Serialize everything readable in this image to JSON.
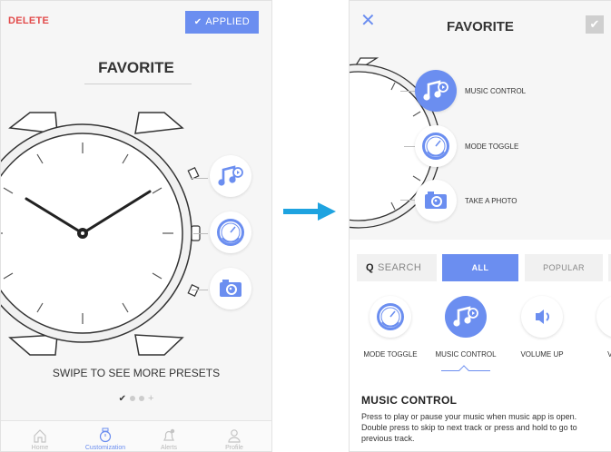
{
  "left": {
    "delete_label": "DELETE",
    "applied_label": "APPLIED",
    "title": "FAVORITE",
    "swipe_text": "SWIPE TO SEE MORE PRESETS",
    "actions": [
      {
        "name": "music-control",
        "icon": "music-note-icon"
      },
      {
        "name": "mode-toggle",
        "icon": "dial-icon"
      },
      {
        "name": "take-a-photo",
        "icon": "camera-icon"
      }
    ],
    "tabs": [
      {
        "label": "Home",
        "icon": "home-icon",
        "active": false
      },
      {
        "label": "Customization",
        "icon": "watch-icon",
        "active": true
      },
      {
        "label": "Alerts",
        "icon": "bell-icon",
        "active": false
      },
      {
        "label": "Profile",
        "icon": "person-icon",
        "active": false
      }
    ]
  },
  "right": {
    "title": "FAVORITE",
    "actions": [
      {
        "label": "MUSIC CONTROL",
        "icon": "music-note-icon"
      },
      {
        "label": "MODE TOGGLE",
        "icon": "dial-icon"
      },
      {
        "label": "TAKE A PHOTO",
        "icon": "camera-icon"
      }
    ],
    "search_label": "SEARCH",
    "filters": [
      "ALL",
      "POPULAR"
    ],
    "active_filter": "ALL",
    "presets": [
      {
        "label": "MODE TOGGLE",
        "icon": "dial-icon"
      },
      {
        "label": "MUSIC CONTROL",
        "icon": "music-note-icon",
        "selected": true
      },
      {
        "label": "VOLUME UP",
        "icon": "speaker-icon"
      },
      {
        "label": "VOLU",
        "icon": "partial-icon"
      }
    ],
    "detail_title": "MUSIC CONTROL",
    "detail_desc": "Press to play or pause your music when music app is open. Double press to skip to next track or press and hold to go to previous track."
  },
  "colors": {
    "accent": "#6b8ef0",
    "delete": "#e24b4b",
    "arrow": "#1ea3e0",
    "text": "#333333"
  }
}
